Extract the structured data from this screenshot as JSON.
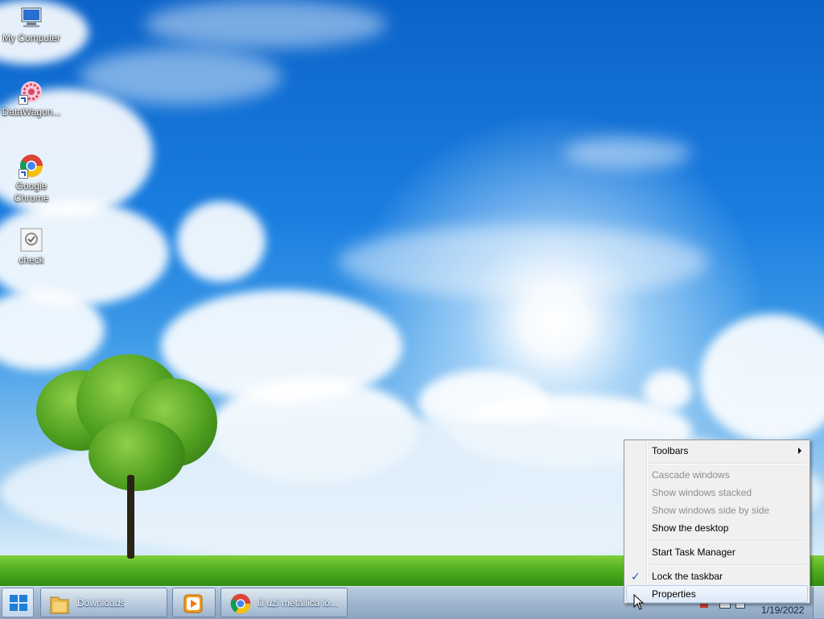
{
  "desktop": {
    "icons": [
      {
        "label": "My Computer",
        "icon": "computer-icon"
      },
      {
        "label": "DataWagon...",
        "icon": "datawagon-icon"
      },
      {
        "label": "Google Chrome",
        "icon": "chrome-icon"
      },
      {
        "label": "check",
        "icon": "check-file-icon"
      }
    ]
  },
  "taskbar": {
    "start_icon": "windows-logo-icon",
    "buttons": [
      {
        "label": "Downloads",
        "icon": "folder-icon"
      },
      {
        "label": "",
        "icon": "media-player-icon"
      },
      {
        "label": "lil uzi metallica lo...",
        "icon": "chrome-icon"
      }
    ],
    "clock_date": "1/19/2022"
  },
  "context_menu": {
    "items": [
      {
        "label": "Toolbars"
      },
      {
        "label": "Cascade windows"
      },
      {
        "label": "Show windows stacked"
      },
      {
        "label": "Show windows side by side"
      },
      {
        "label": "Show the desktop"
      },
      {
        "label": "Start Task Manager"
      },
      {
        "label": "Lock the taskbar"
      },
      {
        "label": "Properties"
      }
    ]
  }
}
